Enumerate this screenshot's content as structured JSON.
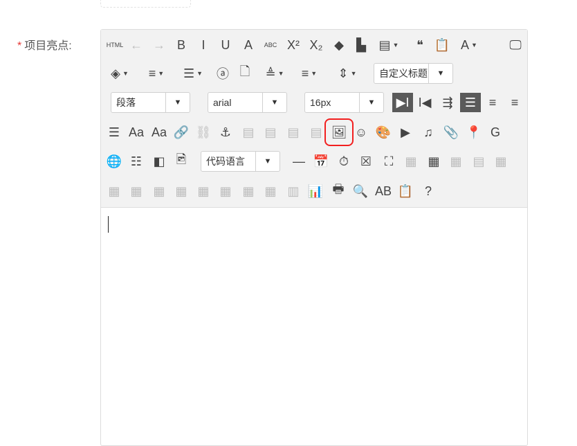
{
  "field": {
    "required_mark": "*",
    "label": "项目亮点:"
  },
  "toolbar": {
    "rows": [
      [
        {
          "name": "html-source-icon",
          "glyph": "HTML",
          "small": true
        },
        {
          "name": "undo-icon",
          "glyph": "←",
          "disabled": true
        },
        {
          "name": "redo-icon",
          "glyph": "→",
          "disabled": true
        },
        {
          "name": "bold-icon",
          "glyph": "B"
        },
        {
          "name": "italic-icon",
          "glyph": "I"
        },
        {
          "name": "underline-icon",
          "glyph": "U"
        },
        {
          "name": "font-border-icon",
          "glyph": "A"
        },
        {
          "name": "strikethrough-icon",
          "glyph": "ABC",
          "small": true
        },
        {
          "name": "superscript-icon",
          "glyph": "X²"
        },
        {
          "name": "subscript-icon",
          "glyph": "X₂"
        },
        {
          "name": "eraser-icon",
          "glyph": "◆"
        },
        {
          "name": "auto-format-icon",
          "glyph": "▙"
        },
        {
          "name": "template-icon",
          "glyph": "▤",
          "caret": true
        },
        {
          "name": "blockquote-icon",
          "glyph": "❝"
        },
        {
          "name": "paste-plain-icon",
          "glyph": "📋"
        },
        {
          "name": "font-color-icon",
          "glyph": "A",
          "caret": true
        },
        {
          "name": "fullscreen-icon",
          "glyph": "🖵"
        }
      ],
      [
        {
          "name": "background-color-icon",
          "glyph": "◈",
          "caret": true
        },
        {
          "name": "ordered-list-icon",
          "glyph": "≡",
          "caret": true
        },
        {
          "name": "unordered-list-icon",
          "glyph": "☰",
          "caret": true
        },
        {
          "name": "select-all-icon",
          "glyph": "ⓐ"
        },
        {
          "name": "clear-doc-icon",
          "glyph": "🗋"
        },
        {
          "name": "paragraph-spacing-icon",
          "glyph": "≜",
          "caret": true
        },
        {
          "name": "row-spacing-icon",
          "glyph": "≡",
          "caret": true
        },
        {
          "name": "line-height-icon",
          "glyph": "⇕",
          "caret": true
        },
        {
          "name": "custom-style-select",
          "select": "自定义标题"
        }
      ],
      [
        {
          "name": "paragraph-select",
          "select": "段落"
        },
        {
          "name": "font-family-select",
          "select": "arial"
        },
        {
          "name": "font-size-select",
          "select": "16px"
        },
        {
          "name": "ltr-direction-icon",
          "glyph": "▶I",
          "active": true
        },
        {
          "name": "rtl-direction-icon",
          "glyph": "I◀"
        },
        {
          "name": "indent-icon",
          "glyph": "⇶"
        },
        {
          "name": "align-left-icon",
          "glyph": "☰",
          "active": true
        },
        {
          "name": "align-center-icon",
          "glyph": "≡"
        },
        {
          "name": "align-right-icon",
          "glyph": "≡"
        }
      ],
      [
        {
          "name": "justify-icon",
          "glyph": "☰"
        },
        {
          "name": "uppercase-icon",
          "glyph": "Aa"
        },
        {
          "name": "lowercase-icon",
          "glyph": "Aa"
        },
        {
          "name": "link-icon",
          "glyph": "🔗"
        },
        {
          "name": "unlink-icon",
          "glyph": "⛓",
          "disabled": true
        },
        {
          "name": "anchor-icon",
          "glyph": "⚓"
        },
        {
          "name": "image-none-icon",
          "glyph": "▤",
          "disabled": true
        },
        {
          "name": "image-left-icon",
          "glyph": "▤",
          "disabled": true
        },
        {
          "name": "image-right-icon",
          "glyph": "▤",
          "disabled": true
        },
        {
          "name": "image-center-icon",
          "glyph": "▤",
          "disabled": true
        },
        {
          "name": "insert-image-icon",
          "glyph": "🖼",
          "highlight": true
        },
        {
          "name": "emotion-icon",
          "glyph": "☺"
        },
        {
          "name": "scrawl-icon",
          "glyph": "🎨"
        },
        {
          "name": "insert-video-icon",
          "glyph": "▶"
        },
        {
          "name": "music-icon",
          "glyph": "♫"
        },
        {
          "name": "attachment-icon",
          "glyph": "📎"
        },
        {
          "name": "map-icon",
          "glyph": "📍"
        },
        {
          "name": "google-map-icon",
          "glyph": "G"
        }
      ],
      [
        {
          "name": "insert-frame-icon",
          "glyph": "🌐"
        },
        {
          "name": "insert-code-icon",
          "glyph": "☷"
        },
        {
          "name": "page-break-icon",
          "glyph": "◧"
        },
        {
          "name": "background-icon",
          "glyph": "🖻"
        },
        {
          "name": "code-language-select",
          "select": "代码语言"
        },
        {
          "name": "horizontal-rule-icon",
          "glyph": "—"
        },
        {
          "name": "date-icon",
          "glyph": "📅"
        },
        {
          "name": "time-icon",
          "glyph": "⏱"
        },
        {
          "name": "spechars-icon",
          "glyph": "☒"
        },
        {
          "name": "snapscreen-icon",
          "glyph": "⛶"
        },
        {
          "name": "word-image-icon",
          "glyph": "▦",
          "disabled": true
        },
        {
          "name": "insert-table-icon",
          "glyph": "▦"
        },
        {
          "name": "delete-table-icon",
          "glyph": "▦",
          "disabled": true
        },
        {
          "name": "insert-caption-icon",
          "glyph": "▤",
          "disabled": true
        },
        {
          "name": "insert-row-above-icon",
          "glyph": "▦",
          "disabled": true
        }
      ],
      [
        {
          "name": "delete-row-icon",
          "glyph": "▦",
          "disabled": true
        },
        {
          "name": "insert-col-icon",
          "glyph": "▦",
          "disabled": true
        },
        {
          "name": "delete-col-icon",
          "glyph": "▦",
          "disabled": true
        },
        {
          "name": "merge-cells-icon",
          "glyph": "▦",
          "disabled": true
        },
        {
          "name": "merge-right-icon",
          "glyph": "▦",
          "disabled": true
        },
        {
          "name": "merge-down-icon",
          "glyph": "▦",
          "disabled": true
        },
        {
          "name": "split-cells-icon",
          "glyph": "▦",
          "disabled": true
        },
        {
          "name": "split-rows-icon",
          "glyph": "▦",
          "disabled": true
        },
        {
          "name": "split-cols-icon",
          "glyph": "▥",
          "disabled": true
        },
        {
          "name": "chart-icon",
          "glyph": "📊",
          "disabled": true
        },
        {
          "name": "print-icon",
          "glyph": "🖶"
        },
        {
          "name": "preview-icon",
          "glyph": "🔍"
        },
        {
          "name": "search-replace-icon",
          "glyph": "AB"
        },
        {
          "name": "paste-word-icon",
          "glyph": "📋",
          "disabled": true
        },
        {
          "name": "help-icon",
          "glyph": "?"
        }
      ]
    ]
  },
  "colors": {
    "highlight": "#f21f1f",
    "toolbar_bg": "#f2f2f2",
    "active": "#5a5a5a"
  }
}
